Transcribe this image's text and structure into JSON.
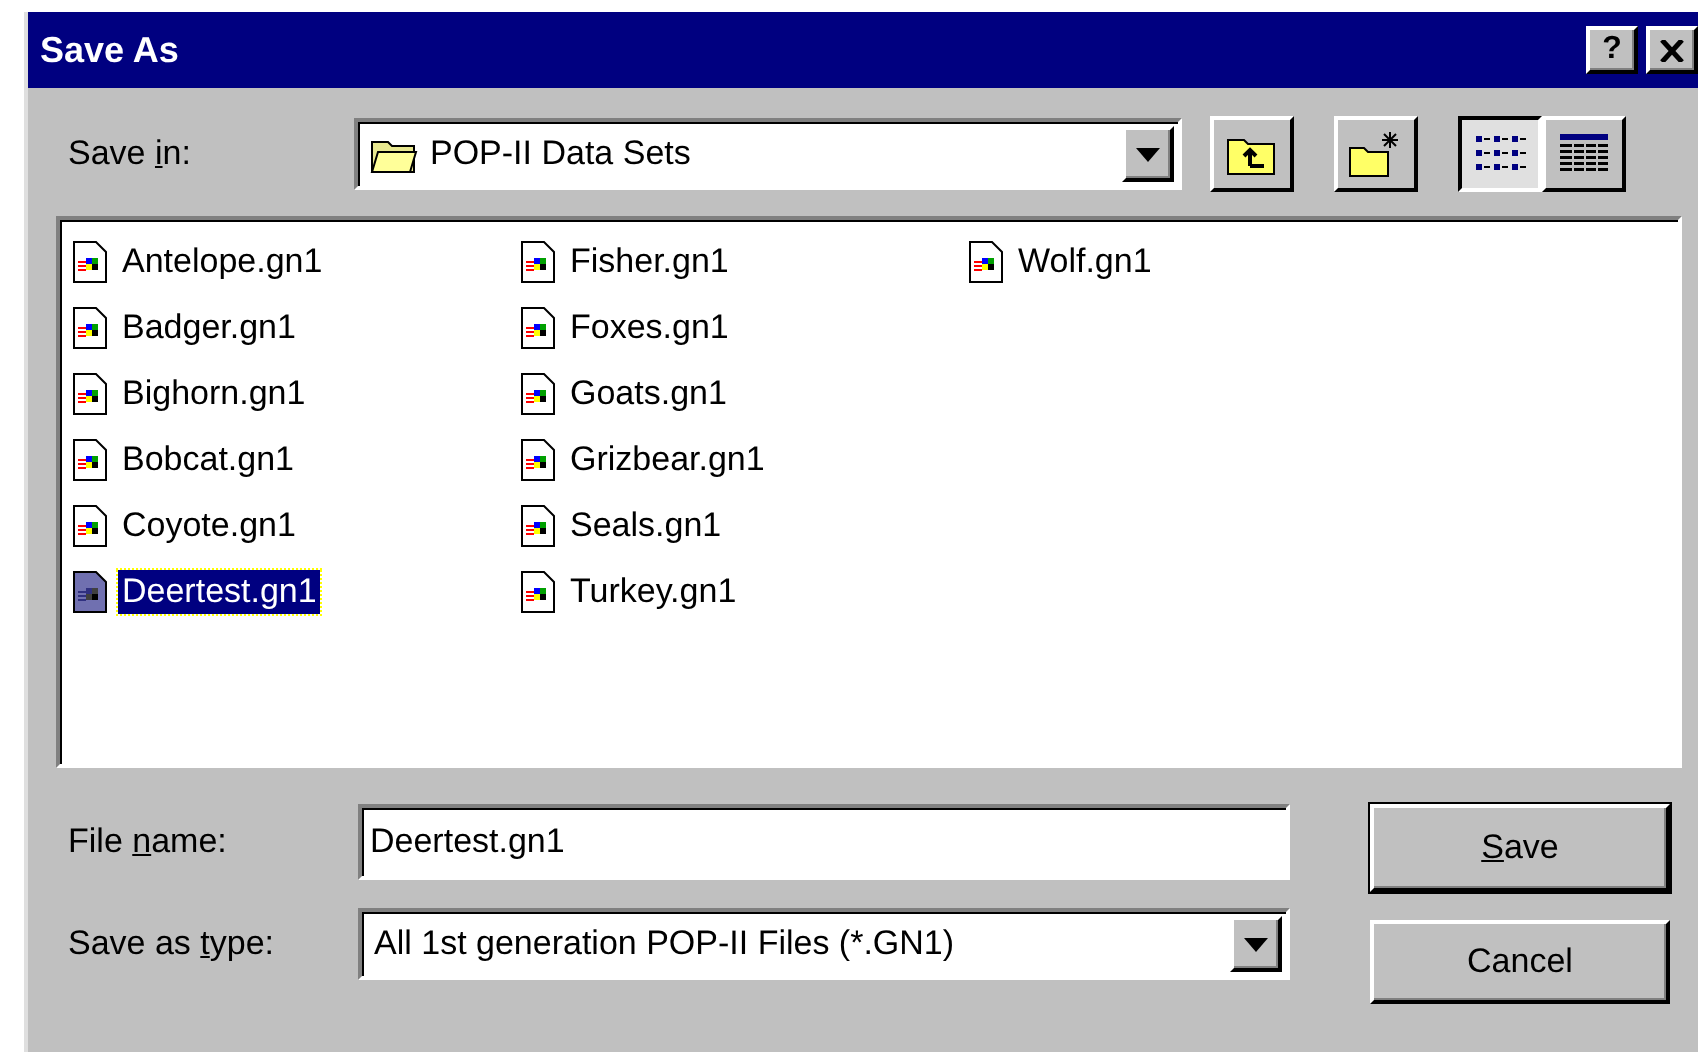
{
  "window": {
    "title": "Save As",
    "help": "?"
  },
  "save_in": {
    "label": {
      "before": "Save ",
      "key": "i",
      "after": "n:"
    },
    "value": "POP-II Data Sets"
  },
  "toolbar": [
    {
      "kind": "up-folder",
      "pressed": false
    },
    {
      "kind": "new-folder",
      "pressed": false
    },
    {
      "kind": "list-view",
      "pressed": true
    },
    {
      "kind": "details-view",
      "pressed": false
    }
  ],
  "files": [
    {
      "name": "Antelope.gn1",
      "selected": false
    },
    {
      "name": "Badger.gn1",
      "selected": false
    },
    {
      "name": "Bighorn.gn1",
      "selected": false
    },
    {
      "name": "Bobcat.gn1",
      "selected": false
    },
    {
      "name": "Coyote.gn1",
      "selected": false
    },
    {
      "name": "Deertest.gn1",
      "selected": true
    },
    {
      "name": "Fisher.gn1",
      "selected": false
    },
    {
      "name": "Foxes.gn1",
      "selected": false
    },
    {
      "name": "Goats.gn1",
      "selected": false
    },
    {
      "name": "Grizbear.gn1",
      "selected": false
    },
    {
      "name": "Seals.gn1",
      "selected": false
    },
    {
      "name": "Turkey.gn1",
      "selected": false
    },
    {
      "name": "Wolf.gn1",
      "selected": false
    }
  ],
  "file_name": {
    "label": {
      "before": "File ",
      "key": "n",
      "after": "ame:"
    },
    "value": "Deertest.gn1"
  },
  "save_as_type": {
    "label": {
      "before": "Save as ",
      "key": "t",
      "after": "ype:"
    },
    "value": "All 1st generation POP-II Files (*.GN1)"
  },
  "buttons": [
    {
      "label": {
        "key": "S",
        "after": "ave"
      },
      "default": true
    },
    {
      "label": {
        "before": "Cancel"
      },
      "default": false
    }
  ]
}
